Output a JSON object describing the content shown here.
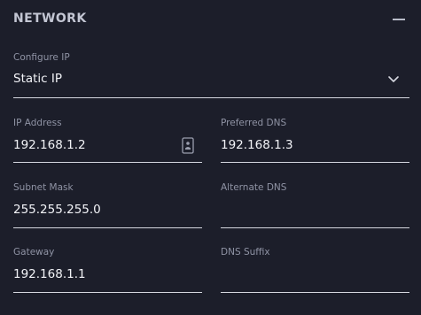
{
  "header": {
    "title": "NETWORK",
    "collapse_icon": "minus-icon"
  },
  "configure_ip": {
    "label": "Configure IP",
    "value": "Static IP",
    "icon": "chevron-down-icon"
  },
  "fields": {
    "ip_address": {
      "label": "IP Address",
      "value": "192.168.1.2",
      "icon": "contact-card-icon"
    },
    "preferred_dns": {
      "label": "Preferred DNS",
      "value": "192.168.1.3"
    },
    "subnet_mask": {
      "label": "Subnet Mask",
      "value": "255.255.255.0"
    },
    "alternate_dns": {
      "label": "Alternate DNS",
      "value": ""
    },
    "gateway": {
      "label": "Gateway",
      "value": "192.168.1.1"
    },
    "dns_suffix": {
      "label": "DNS Suffix",
      "value": ""
    }
  },
  "colors": {
    "background": "#1c1e2a",
    "text": "#f2f3f7",
    "label": "#8f93a4",
    "underline": "#d6d8e0"
  }
}
